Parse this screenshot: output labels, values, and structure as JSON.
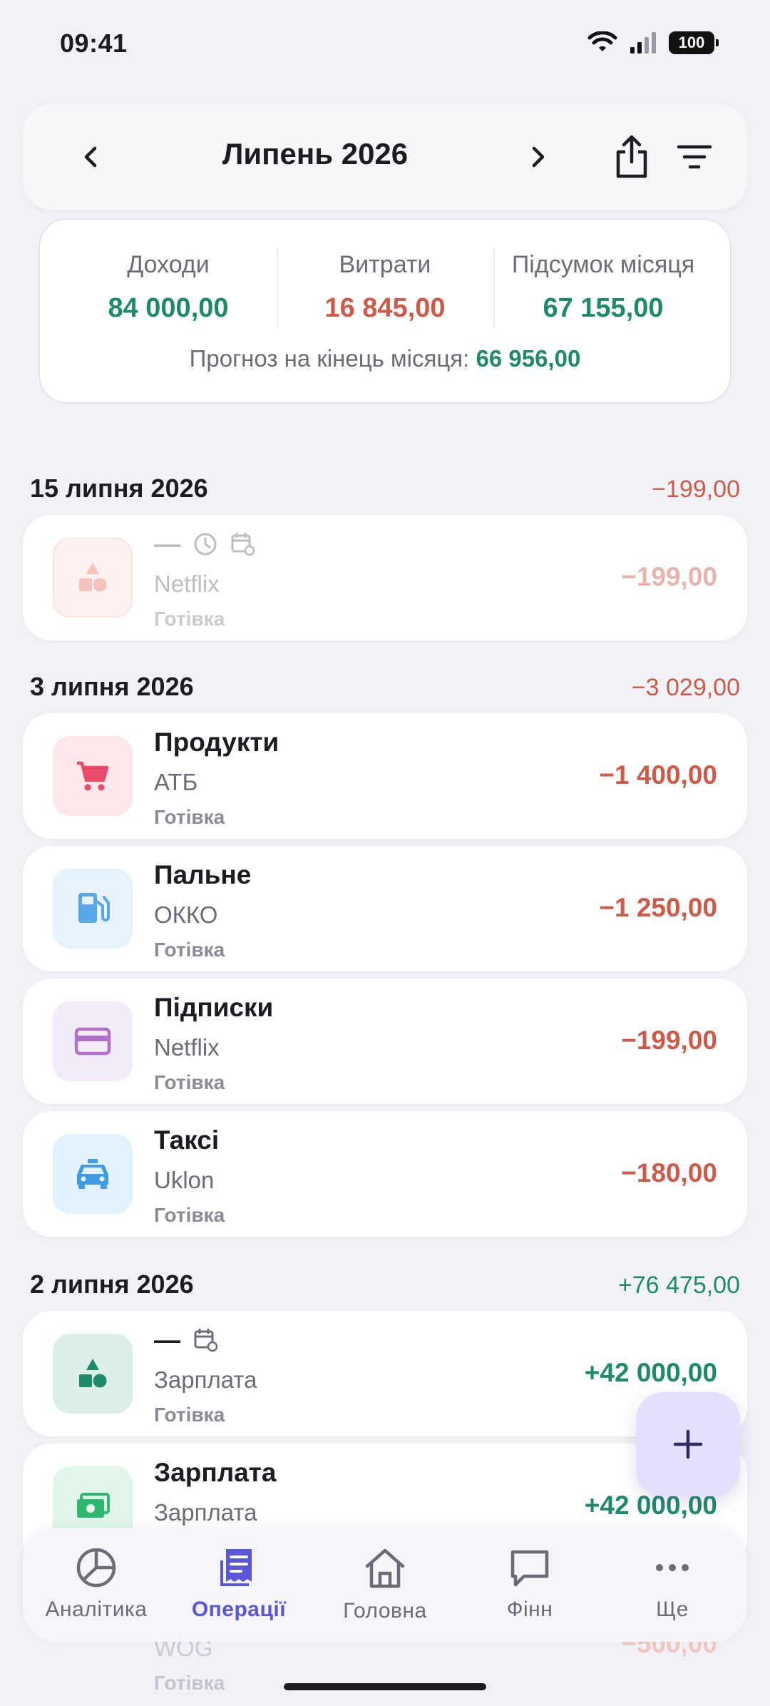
{
  "status_bar": {
    "time": "09:41",
    "battery": "100"
  },
  "header": {
    "month_title": "Липень 2026"
  },
  "summary": {
    "income_label": "Доходи",
    "income_value": "84 000,00",
    "expense_label": "Витрати",
    "expense_value": "16 845,00",
    "total_label": "Підсумок місяця",
    "total_value": "67 155,00",
    "forecast_label": "Прогноз на кінець місяця:",
    "forecast_value": "66 956,00"
  },
  "groups": [
    {
      "date": "15 липня 2026",
      "total": "−199,00",
      "transactions": [
        {
          "title": "—",
          "merchant": "Netflix",
          "account": "Готівка",
          "amount": "−199,00",
          "icon": "shapes-icon",
          "color": "#e77a6a",
          "bg": "#fbe3df",
          "pending": true
        }
      ]
    },
    {
      "date": "3 липня 2026",
      "total": "−3 029,00",
      "transactions": [
        {
          "title": "Продукти",
          "merchant": "АТБ",
          "account": "Готівка",
          "amount": "−1 400,00",
          "icon": "cart-icon",
          "color": "#ea4b68",
          "bg": "#fde7eb"
        },
        {
          "title": "Пальне",
          "merchant": "ОККО",
          "account": "Готівка",
          "amount": "−1 250,00",
          "icon": "fuel-icon",
          "color": "#5aa8e6",
          "bg": "#e6f3fd"
        },
        {
          "title": "Підписки",
          "merchant": "Netflix",
          "account": "Готівка",
          "amount": "−199,00",
          "icon": "card-icon",
          "color": "#b072c9",
          "bg": "#f4ebf8"
        },
        {
          "title": "Таксі",
          "merchant": "Uklon",
          "account": "Готівка",
          "amount": "−180,00",
          "icon": "taxi-icon",
          "color": "#3f9be6",
          "bg": "#e3f1fd"
        }
      ]
    },
    {
      "date": "2 липня 2026",
      "total": "+76 475,00",
      "transactions": [
        {
          "title": "—",
          "merchant": "Зарплата",
          "account": "Готівка",
          "amount": "+42 000,00",
          "icon": "shapes-icon",
          "color": "#1f8a6b",
          "bg": "#dcefe8"
        },
        {
          "title": "Зарплата",
          "merchant": "Зарплата",
          "account": "",
          "amount": "+42 000,00",
          "icon": "cash-icon",
          "color": "#2fb66f",
          "bg": "#dff6e8"
        }
      ]
    }
  ],
  "peek_row": {
    "merchant": "WOG",
    "account": "Готівка",
    "amount": "−500,00"
  },
  "nav": [
    {
      "label": "Аналітика",
      "icon": "pie-chart-icon",
      "active": false
    },
    {
      "label": "Операції",
      "icon": "receipt-icon",
      "active": true
    },
    {
      "label": "Головна",
      "icon": "home-icon",
      "active": false
    },
    {
      "label": "Фінн",
      "icon": "chat-icon",
      "active": false
    },
    {
      "label": "Ще",
      "icon": "more-icon",
      "active": false
    }
  ],
  "colors": {
    "accent": "#5a55d9",
    "income": "#1f8a6b",
    "expense": "#cc5b4a"
  }
}
